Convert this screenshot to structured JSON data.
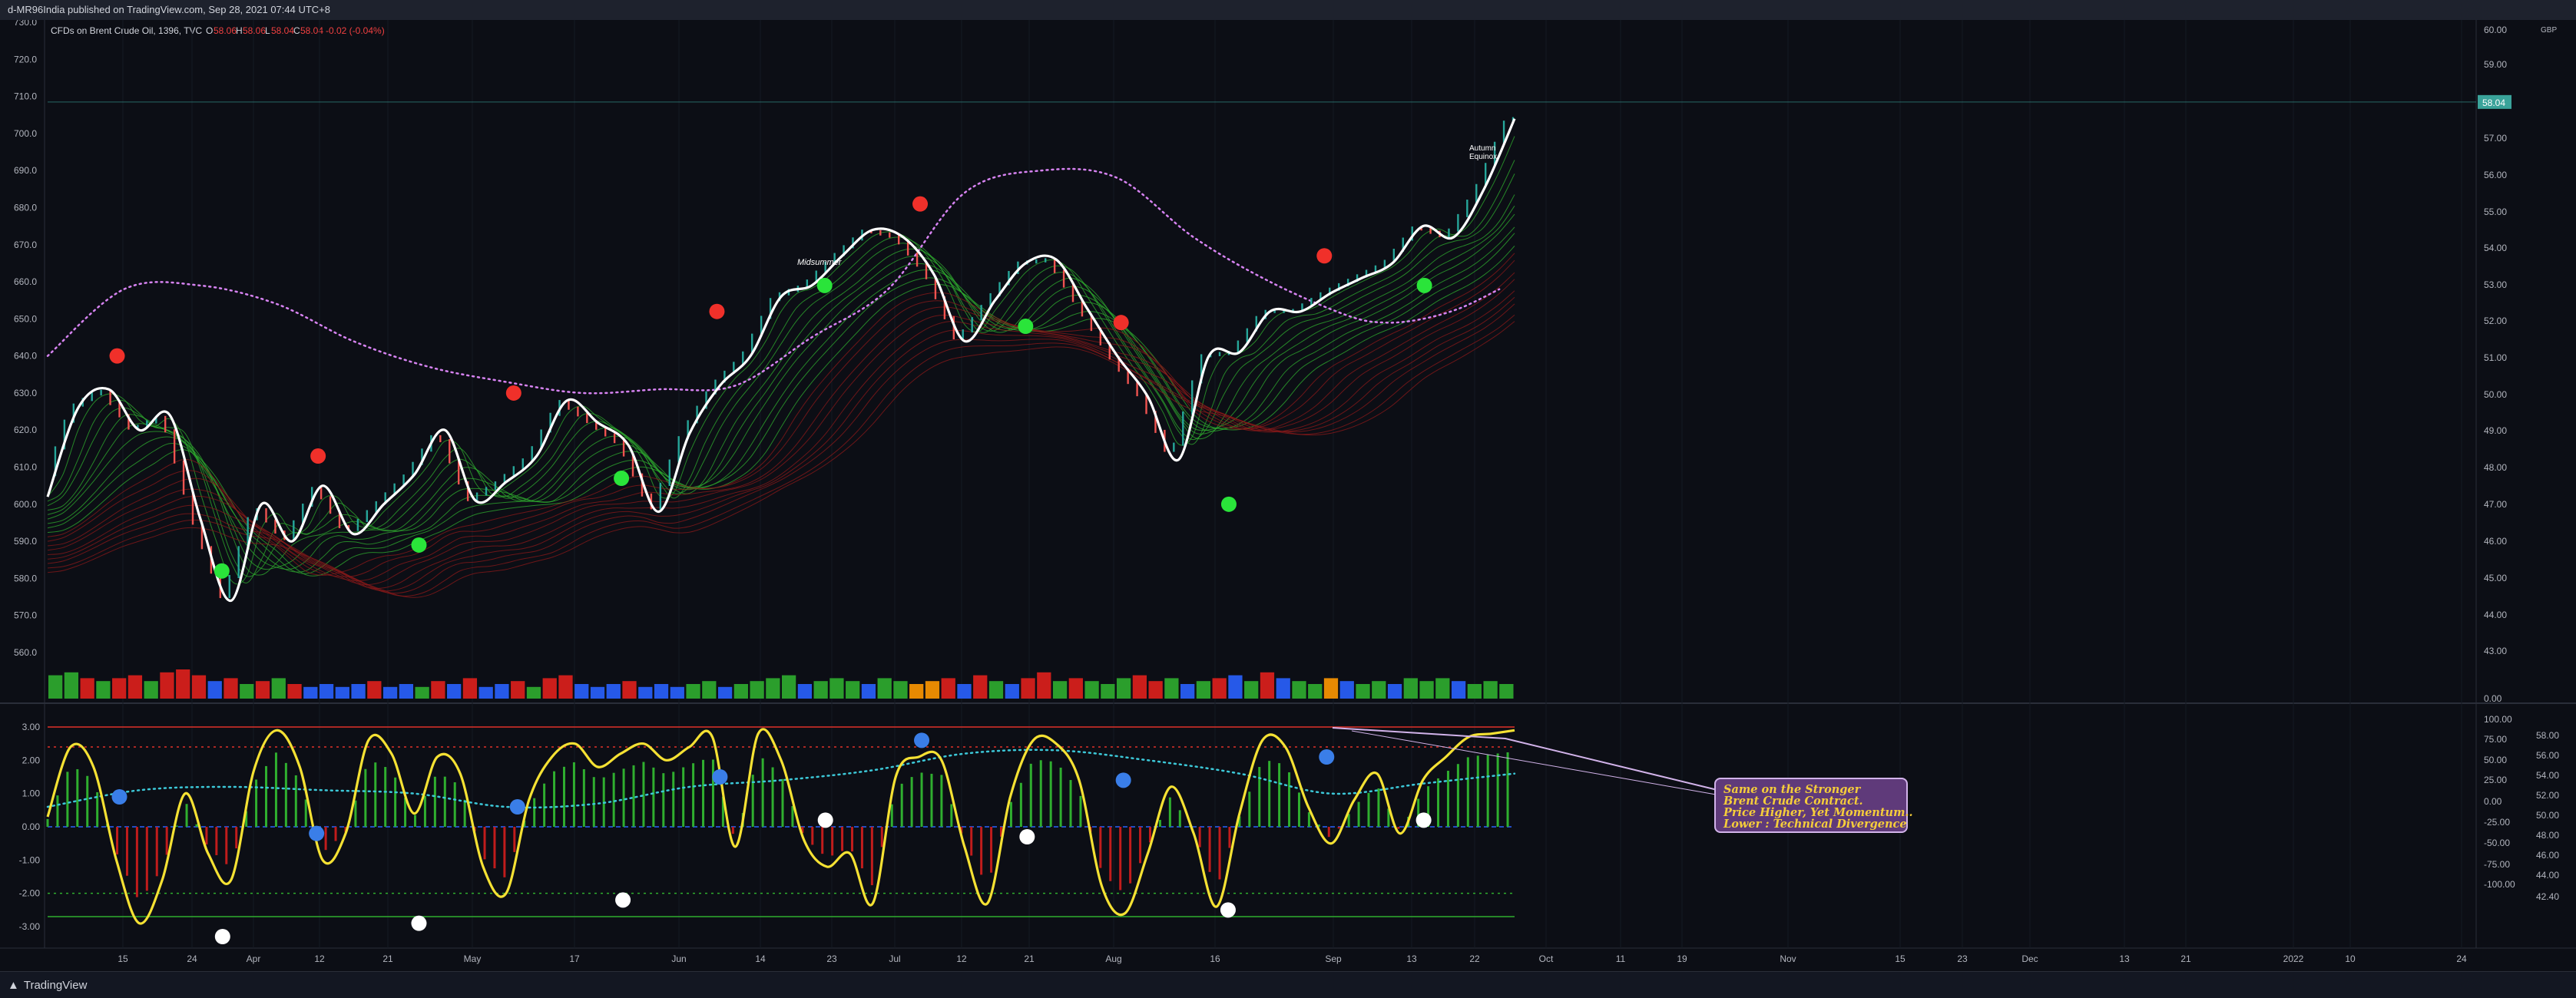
{
  "header": {
    "publisher_line": "d-MR96India published on TradingView.com, Sep 28, 2021 07:44 UTC+8",
    "symbol": "CFDs on Brent Crude Oil, 1396, TVC",
    "ohlc": {
      "o_label": "O",
      "o": "58.06",
      "h_label": "H",
      "h": "58.06",
      "l_label": "L",
      "l": "58.04",
      "c_label": "C",
      "c": "58.04",
      "change": "-0.02 (-0.04%)"
    }
  },
  "footer": {
    "brand": "TradingView"
  },
  "annotations": {
    "midsummer": "Midsummer",
    "autumn_line1": "Autumn",
    "autumn_line2": "Equinox",
    "note_lines": [
      "Same on the Stronger",
      "Brent Crude Contract.",
      "Price Higher, Yet Momentum..",
      "Lower : Technical Divergence"
    ]
  },
  "colors": {
    "background": "#0c0e15",
    "price_line": "#ffffff",
    "ribbon_bull": "#2fae2f",
    "ribbon_bear": "#8c1a1a",
    "envelope": "#d783f2",
    "dot_red": "#f0302a",
    "dot_green": "#2ae43a",
    "dot_blue": "#3a7ee8",
    "dot_white": "#ffffff",
    "osc_line": "#f5e133",
    "hist_up": "#2fae2f",
    "hist_down": "#c01c1c",
    "signal": "#3cc8d8",
    "price_tag": "#3aa39a"
  },
  "chart_data": [
    {
      "type": "line",
      "title": "",
      "ylim": [
        555,
        730
      ],
      "y_ticks": [
        "730.0",
        "720.0",
        "710.0",
        "700.0",
        "690.0",
        "680.0",
        "670.0",
        "660.0",
        "650.0",
        "640.0",
        "630.0",
        "620.0",
        "610.0",
        "600.0",
        "590.0",
        "580.0",
        "570.0",
        "560.0"
      ],
      "right_axis_ticks": [
        "60.00",
        "59.00",
        "58.00",
        "57.00",
        "56.00",
        "55.00",
        "54.00",
        "53.00",
        "52.00",
        "51.00",
        "50.00",
        "49.00",
        "48.00",
        "47.00",
        "46.00",
        "45.00",
        "44.00",
        "43.00",
        "0.00"
      ],
      "right_axis_unit": "GBP",
      "last_price_tag": "58.04",
      "x_labels": [
        "15",
        "24",
        "Apr",
        "12",
        "21",
        "May",
        "17",
        "Jun",
        "14",
        "23",
        "Jul",
        "12",
        "21",
        "Aug",
        "16",
        "Sep",
        "13",
        "22",
        "Oct",
        "11",
        "19",
        "Nov",
        "15",
        "23",
        "Dec",
        "13",
        "21",
        "2022",
        "10",
        "24"
      ],
      "series": [
        {
          "x": [
            0,
            4,
            8,
            12,
            16,
            20,
            24,
            28,
            32,
            36,
            40,
            44,
            48,
            52,
            56,
            60,
            64,
            68,
            72,
            76,
            80,
            84,
            88,
            92,
            96,
            100,
            104,
            108,
            112,
            116,
            120,
            124,
            128,
            132,
            136,
            140,
            144,
            148,
            152,
            156,
            160,
            164,
            168,
            172,
            176,
            180,
            184,
            188,
            192
          ],
          "values": [
            602,
            626,
            631,
            620,
            624,
            596,
            574,
            600,
            590,
            605,
            592,
            600,
            608,
            620,
            601,
            606,
            613,
            628,
            622,
            616,
            598,
            619,
            632,
            640,
            656,
            659,
            667,
            674,
            672,
            662,
            644,
            655,
            665,
            666,
            653,
            640,
            629,
            612,
            640,
            641,
            652,
            652,
            657,
            661,
            665,
            675,
            672,
            685,
            704
          ]
        },
        {
          "name": "",
          "x": [
            0,
            10,
            20,
            30,
            40,
            50,
            60,
            70,
            80,
            90,
            100,
            110,
            120,
            130,
            140,
            150,
            160,
            170,
            175,
            180,
            185,
            190
          ],
          "values": [
            640,
            658,
            659,
            654,
            644,
            637,
            633,
            630,
            631,
            632,
            645,
            658,
            684,
            690,
            688,
            672,
            660,
            651,
            649,
            650,
            653,
            658
          ]
        }
      ],
      "signals": {
        "red": [
          {
            "x": 9.1,
            "y": 640
          },
          {
            "x": 35.4,
            "y": 613
          },
          {
            "x": 61.0,
            "y": 630
          },
          {
            "x": 87.6,
            "y": 652
          },
          {
            "x": 114.2,
            "y": 681
          },
          {
            "x": 140.5,
            "y": 649
          },
          {
            "x": 167.1,
            "y": 667
          }
        ],
        "green": [
          {
            "x": 22.8,
            "y": 582
          },
          {
            "x": 48.6,
            "y": 589
          },
          {
            "x": 75.1,
            "y": 607
          },
          {
            "x": 101.7,
            "y": 659
          },
          {
            "x": 128.0,
            "y": 648
          },
          {
            "x": 154.6,
            "y": 600
          },
          {
            "x": 180.2,
            "y": 659
          }
        ]
      }
    },
    {
      "type": "bar",
      "title": "",
      "volume_colors": [
        "g",
        "g",
        "r",
        "g",
        "r",
        "r",
        "g",
        "r",
        "r",
        "r",
        "b",
        "r",
        "g",
        "r",
        "g",
        "r",
        "b",
        "b",
        "b",
        "b",
        "r",
        "b",
        "b",
        "g",
        "r",
        "b",
        "r",
        "b",
        "b",
        "r",
        "g",
        "r",
        "r",
        "b",
        "b",
        "b",
        "r",
        "b",
        "b",
        "b",
        "g",
        "g",
        "b",
        "g",
        "g",
        "g",
        "g",
        "b",
        "g",
        "g",
        "g",
        "b",
        "g",
        "g",
        "o",
        "o",
        "r",
        "b",
        "r",
        "g",
        "b",
        "r",
        "r",
        "g",
        "r",
        "g",
        "g",
        "g",
        "r",
        "r",
        "g",
        "b",
        "g",
        "r",
        "b",
        "g",
        "r",
        "b",
        "g",
        "g",
        "o",
        "b",
        "g",
        "g",
        "b",
        "g",
        "g",
        "g",
        "b",
        "g",
        "g",
        "g"
      ],
      "volume_values": [
        0.8,
        0.9,
        0.7,
        0.6,
        0.7,
        0.8,
        0.6,
        0.9,
        1.0,
        0.8,
        0.6,
        0.7,
        0.5,
        0.6,
        0.7,
        0.5,
        0.4,
        0.5,
        0.4,
        0.5,
        0.6,
        0.4,
        0.5,
        0.4,
        0.6,
        0.5,
        0.7,
        0.4,
        0.5,
        0.6,
        0.4,
        0.7,
        0.8,
        0.5,
        0.4,
        0.5,
        0.6,
        0.4,
        0.5,
        0.4,
        0.5,
        0.6,
        0.4,
        0.5,
        0.6,
        0.7,
        0.8,
        0.5,
        0.6,
        0.7,
        0.6,
        0.5,
        0.7,
        0.6,
        0.5,
        0.6,
        0.7,
        0.5,
        0.8,
        0.6,
        0.5,
        0.7,
        0.9,
        0.6,
        0.7,
        0.6,
        0.5,
        0.7,
        0.8,
        0.6,
        0.7,
        0.5,
        0.6,
        0.7,
        0.8,
        0.6,
        0.9,
        0.7,
        0.6,
        0.5,
        0.7,
        0.6,
        0.5,
        0.6,
        0.5,
        0.7,
        0.6,
        0.7,
        0.6,
        0.5,
        0.6,
        0.5
      ]
    },
    {
      "type": "line",
      "title": "",
      "ylim": [
        -3.6,
        3.6
      ],
      "y_ticks": [
        "3.00",
        "2.00",
        "1.00",
        "0.00",
        "-1.00",
        "-2.00",
        "-3.00"
      ],
      "right_axis_ticks": [
        "100.00",
        "75.00",
        "50.00",
        "25.00",
        "0.00",
        "-25.00",
        "-50.00",
        "-75.00",
        "-100.00"
      ],
      "right_axis_ticks2": [
        "58.00",
        "56.00",
        "54.00",
        "52.00",
        "50.00",
        "48.00",
        "46.00",
        "44.00",
        "42.40"
      ],
      "levels": {
        "top": 3.0,
        "upper_dotted": 2.4,
        "lower_dotted": -2.0,
        "bottom": -2.7
      },
      "series": [
        {
          "x": [
            0,
            3,
            6,
            9,
            12,
            15,
            18,
            21,
            24,
            27,
            30,
            33,
            36,
            39,
            42,
            45,
            48,
            51,
            54,
            57,
            60,
            63,
            66,
            69,
            72,
            75,
            78,
            81,
            84,
            87,
            90,
            93,
            96,
            99,
            102,
            105,
            108,
            111,
            114,
            117,
            120,
            123,
            126,
            129,
            132,
            135,
            138,
            141,
            144,
            147,
            150,
            153,
            156,
            159,
            162,
            165,
            168,
            171,
            174,
            177,
            180,
            183,
            186,
            189,
            192
          ],
          "values": [
            0.3,
            2.4,
            1.8,
            -1.0,
            -2.9,
            -1.6,
            1.0,
            -0.8,
            -1.6,
            1.7,
            2.9,
            1.8,
            -1.0,
            -0.2,
            2.6,
            2.2,
            0.4,
            2.1,
            1.6,
            -1.2,
            -2.0,
            0.8,
            2.1,
            2.5,
            1.8,
            2.2,
            2.5,
            2.0,
            2.4,
            2.7,
            -0.6,
            2.8,
            2.0,
            -0.4,
            -1.2,
            -0.8,
            -2.3,
            1.5,
            2.1,
            2.0,
            -0.6,
            -2.3,
            0.9,
            2.6,
            2.5,
            1.4,
            -1.8,
            -2.6,
            -0.8,
            1.2,
            -0.2,
            -2.4,
            0.4,
            2.6,
            2.4,
            0.6,
            -0.5,
            0.8,
            1.6,
            -0.2,
            1.4,
            2.1,
            2.7,
            2.8,
            2.9
          ]
        },
        {
          "name": "",
          "x": [
            0,
            12,
            24,
            36,
            48,
            60,
            72,
            84,
            96,
            108,
            120,
            132,
            144,
            156,
            168,
            180,
            192
          ],
          "values": [
            0.6,
            1.1,
            1.2,
            1.1,
            1.0,
            0.6,
            0.7,
            1.2,
            1.4,
            1.7,
            2.2,
            2.3,
            2.0,
            1.6,
            1.0,
            1.3,
            1.6
          ]
        }
      ],
      "signals": {
        "blue": [
          {
            "x": 9.4,
            "y": 0.9
          },
          {
            "x": 35.2,
            "y": -0.2
          },
          {
            "x": 61.5,
            "y": 0.6
          },
          {
            "x": 88.0,
            "y": 1.5
          },
          {
            "x": 114.4,
            "y": 2.6
          },
          {
            "x": 140.8,
            "y": 1.4
          },
          {
            "x": 167.4,
            "y": 2.1
          }
        ],
        "white": [
          {
            "x": 22.9,
            "y": -3.3
          },
          {
            "x": 48.6,
            "y": -2.9
          },
          {
            "x": 75.3,
            "y": -2.2
          },
          {
            "x": 101.8,
            "y": 0.2
          },
          {
            "x": 128.2,
            "y": -0.3
          },
          {
            "x": 154.5,
            "y": -2.5
          },
          {
            "x": 180.1,
            "y": 0.2
          }
        ]
      }
    }
  ]
}
